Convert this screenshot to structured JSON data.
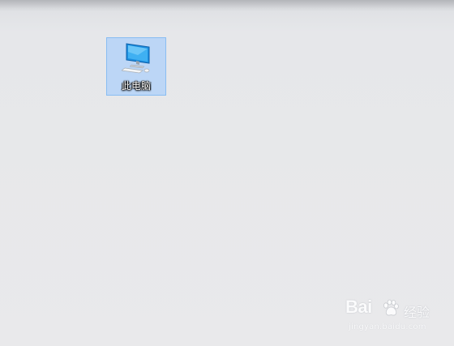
{
  "desktop": {
    "icons": [
      {
        "label": "此电脑",
        "icon": "computer-monitor-icon",
        "selected": true
      }
    ],
    "background_color": "#e8e8ea",
    "selection_color": "#99c9ff"
  },
  "watermark": {
    "brand": "Bai",
    "paw_icon": "baidu-paw-icon",
    "brand_cn": "经验",
    "url": "jingyan.baidu.com"
  }
}
